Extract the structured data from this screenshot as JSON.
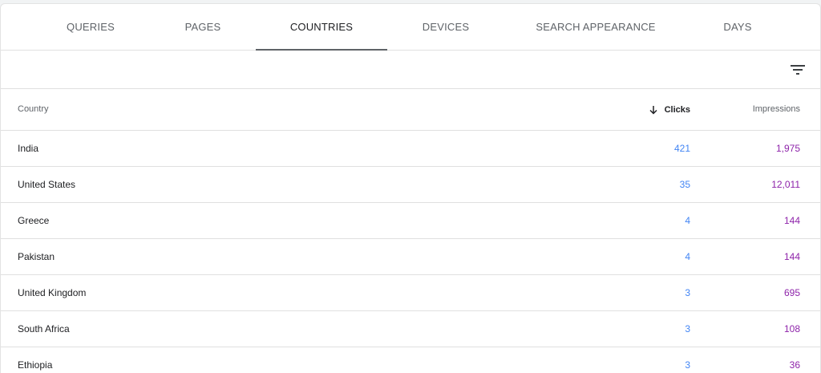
{
  "tabs": [
    {
      "label": "QUERIES"
    },
    {
      "label": "PAGES"
    },
    {
      "label": "COUNTRIES"
    },
    {
      "label": "DEVICES"
    },
    {
      "label": "SEARCH APPEARANCE"
    },
    {
      "label": "DAYS"
    }
  ],
  "active_tab": "COUNTRIES",
  "toolbar": {
    "filter_icon": "filter-list-icon"
  },
  "table": {
    "headers": {
      "country": "Country",
      "clicks": "Clicks",
      "impressions": "Impressions"
    },
    "sort": {
      "column": "Clicks",
      "direction": "descending",
      "icon": "arrow-down-icon"
    },
    "rows": [
      {
        "country": "India",
        "clicks": "421",
        "impressions": "1,975"
      },
      {
        "country": "United States",
        "clicks": "35",
        "impressions": "12,011"
      },
      {
        "country": "Greece",
        "clicks": "4",
        "impressions": "144"
      },
      {
        "country": "Pakistan",
        "clicks": "4",
        "impressions": "144"
      },
      {
        "country": "United Kingdom",
        "clicks": "3",
        "impressions": "695"
      },
      {
        "country": "South Africa",
        "clicks": "3",
        "impressions": "108"
      },
      {
        "country": "Ethiopia",
        "clicks": "3",
        "impressions": "36"
      }
    ]
  },
  "colors": {
    "clicks": "#4285f4",
    "impressions": "#8e24aa",
    "active_underline": "#5f6368"
  }
}
